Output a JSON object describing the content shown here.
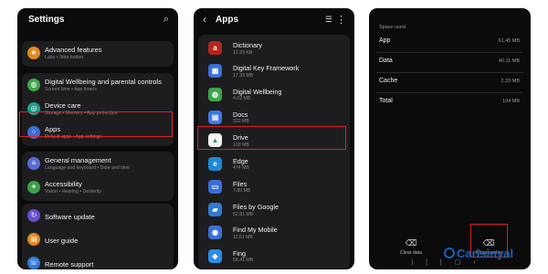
{
  "settings": {
    "title": "Settings",
    "groups": [
      [
        {
          "label": "Advanced features",
          "sub": "Labs  •  Side button",
          "icon": "star-icon",
          "glyph": "★",
          "color": "#e08a21"
        }
      ],
      [
        {
          "label": "Digital Wellbeing and parental controls",
          "sub": "Screen time  •  App timers",
          "icon": "wellbeing-icon",
          "glyph": "◍",
          "color": "#3fa64a"
        },
        {
          "label": "Device care",
          "sub": "Storage  •  Memory  •  App protection",
          "icon": "device-care-icon",
          "glyph": "◎",
          "color": "#1f9e88"
        },
        {
          "label": "Apps",
          "sub": "Default apps  •  App settings",
          "icon": "apps-grid-icon",
          "glyph": "⁘",
          "color": "#3a6fd8"
        }
      ],
      [
        {
          "label": "General management",
          "sub": "Language and keyboard  •  Date and time",
          "icon": "sliders-icon",
          "glyph": "≡",
          "color": "#5b6bd6"
        },
        {
          "label": "Accessibility",
          "sub": "Vision  •  Hearing  •  Dexterity",
          "icon": "accessibility-icon",
          "glyph": "✦",
          "color": "#3aa14a"
        }
      ],
      [
        {
          "label": "Software update",
          "sub": "",
          "icon": "update-icon",
          "glyph": "↻",
          "color": "#6a4fd1"
        },
        {
          "label": "User guide",
          "sub": "",
          "icon": "user-guide-icon",
          "glyph": "▤",
          "color": "#e08a21"
        },
        {
          "label": "Remote support",
          "sub": "",
          "icon": "remote-support-icon",
          "glyph": "☏",
          "color": "#2f7bd3"
        }
      ]
    ]
  },
  "apps": {
    "title": "Apps",
    "list": [
      {
        "name": "Dictionary",
        "size": "12.29 KB",
        "icon": "dictionary-icon",
        "glyph": "a",
        "color": "#b3261e"
      },
      {
        "name": "Digital Key Framework",
        "size": "17.33 MB",
        "icon": "digital-key-icon",
        "glyph": "▣",
        "color": "#3a6fd8"
      },
      {
        "name": "Digital Wellbeing",
        "size": "4.02 MB",
        "icon": "digital-wellbeing-icon",
        "glyph": "◍",
        "color": "#3fa64a"
      },
      {
        "name": "Docs",
        "size": "322 MB",
        "icon": "docs-icon",
        "glyph": "▤",
        "color": "#3b78e7"
      },
      {
        "name": "Drive",
        "size": "102 MB",
        "icon": "drive-icon",
        "glyph": "▲",
        "color": "#f4f4f4"
      },
      {
        "name": "Edge",
        "size": "474 MB",
        "icon": "edge-icon",
        "glyph": "e",
        "color": "#1b8ad6"
      },
      {
        "name": "Files",
        "size": "7.80 MB",
        "icon": "files-icon",
        "glyph": "▭",
        "color": "#3a6fd8"
      },
      {
        "name": "Files by Google",
        "size": "52.81 MB",
        "icon": "files-by-google-icon",
        "glyph": "▰",
        "color": "#2f7bd3"
      },
      {
        "name": "Find My Mobile",
        "size": "11.61 MB",
        "icon": "find-my-mobile-icon",
        "glyph": "◉",
        "color": "#3a6fd8"
      },
      {
        "name": "Fing",
        "size": "58.41 MB",
        "icon": "fing-icon",
        "glyph": "◈",
        "color": "#2a8ce8"
      }
    ]
  },
  "storage": {
    "section": "Space used",
    "rows": [
      {
        "key": "App",
        "value": "61.45 MB"
      },
      {
        "key": "Data",
        "value": "40.11 MB"
      },
      {
        "key": "Cache",
        "value": "2.29 MB"
      },
      {
        "key": "Total",
        "value": "104 MB"
      }
    ],
    "clear_data": "Clear data",
    "clear_cache": "Clear cache"
  },
  "watermark": "Carisinyal",
  "colors": {
    "highlight": "#d6232b",
    "panel_bg": "#0b0b0b",
    "card_bg": "#1d1d1f",
    "watermark": "#1a63b8"
  }
}
